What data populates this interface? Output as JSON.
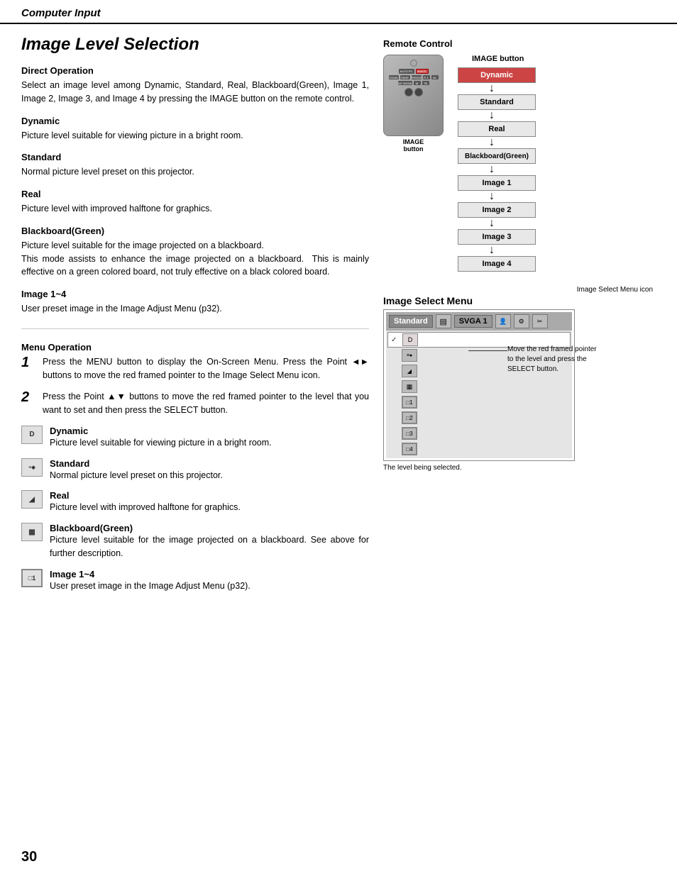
{
  "header": {
    "title": "Computer Input"
  },
  "page": {
    "title": "Image Level Selection",
    "page_number": "30"
  },
  "direct_operation": {
    "heading": "Direct Operation",
    "body": "Select an image level among Dynamic, Standard, Real, Blackboard(Green), Image 1, Image 2, Image 3, and Image 4 by pressing the IMAGE button on the remote control."
  },
  "levels": [
    {
      "name": "Dynamic",
      "description": "Picture level suitable for viewing picture in a bright room.",
      "icon": "D"
    },
    {
      "name": "Standard",
      "description": "Normal picture level preset on this projector.",
      "icon": "S"
    },
    {
      "name": "Real",
      "description": "Picture level with improved halftone for graphics.",
      "icon": "R"
    },
    {
      "name": "Blackboard(Green)",
      "description": "Picture level suitable for the image projected on a blackboard.\nThis mode assists to enhance the image projected on a blackboard.  This is mainly effective on a green colored board, not truly effective on a black colored board.",
      "icon": "B"
    },
    {
      "name": "Image 1~4",
      "description": "User preset image in the Image Adjust Menu (p32).",
      "icon": "1~4"
    }
  ],
  "menu_operation": {
    "heading": "Menu Operation",
    "step1": "Press the MENU button to display the On-Screen Menu.  Press the Point ◄► buttons to move the red framed pointer to the Image Select Menu icon.",
    "step2": "Press the Point ▲▼ buttons to move the red framed pointer to the level that you want to set and then press the SELECT button."
  },
  "menu_items": [
    {
      "name": "Dynamic",
      "icon": "D",
      "heading": "Dynamic",
      "description": "Picture level suitable for viewing picture in a bright room."
    },
    {
      "name": "Standard",
      "icon": "≡",
      "heading": "Standard",
      "description": "Normal picture level preset on this projector."
    },
    {
      "name": "Real",
      "icon": "◢",
      "heading": "Real",
      "description": "Picture level with improved halftone for graphics."
    },
    {
      "name": "Blackboard(Green)",
      "icon": "▦",
      "heading": "Blackboard(Green)",
      "description": "Picture level suitable for the image projected on a blackboard.  See above for further description."
    },
    {
      "name": "Image 1~4",
      "icon": "1",
      "heading": "Image 1~4",
      "description": "User preset image in the Image Adjust Menu (p32)."
    }
  ],
  "remote_control": {
    "label": "Remote Control",
    "image_button_label": "IMAGE button",
    "image_label": "IMAGE\nbutton"
  },
  "image_sequence": [
    "Dynamic",
    "Standard",
    "Real",
    "Blackboard(Green)",
    "Image 1",
    "Image 2",
    "Image 3",
    "Image 4"
  ],
  "image_select_menu": {
    "label": "Image Select Menu",
    "icon_label": "Image Select Menu icon",
    "top_bar_text": "Standard",
    "top_bar_channel": "SVGA 1",
    "callout_text": "Move the red framed pointer to the level and press the SELECT button.",
    "selected_label": "The level being selected."
  }
}
